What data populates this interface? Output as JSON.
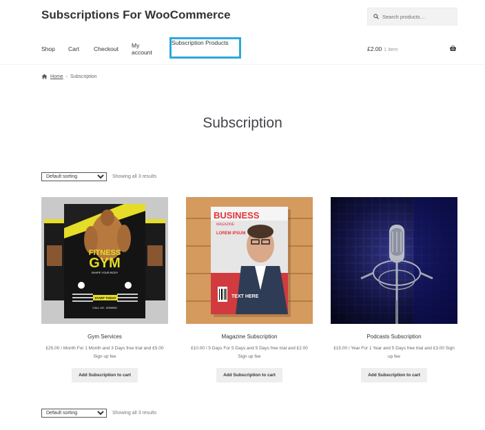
{
  "site": {
    "title": "Subscriptions For WooCommerce"
  },
  "search": {
    "placeholder": "Search products…"
  },
  "nav": {
    "shop": "Shop",
    "cart": "Cart",
    "checkout": "Checkout",
    "my_account": "My account",
    "subscription_products": "Subscription Products"
  },
  "cart": {
    "total": "£2.00",
    "count": "1 item"
  },
  "breadcrumb": {
    "home": "Home",
    "current": "Subscription"
  },
  "page": {
    "title": "Subscription"
  },
  "sorting": {
    "selected": "Default sorting",
    "result_count": "Showing all 3 results"
  },
  "products": [
    {
      "name": "Gym Services",
      "price": "£25.00 / Month For 1 Month and 3 Days free trial and £5.00 Sign up fee",
      "button": "Add Subscription to cart",
      "image_text": {
        "line1": "FITNESS",
        "line2": "GYM",
        "tagline": "SHAPE YOUR BODY",
        "cta": "START TODAY",
        "call": "CALL US : 0000000"
      }
    },
    {
      "name": "Magazine Subscription",
      "price": "£10.00 / 5 Days For 5 Days and 5 Days free trial and £2.00 Sign up fee",
      "button": "Add Subscription to cart",
      "image_text": {
        "masthead": "BUSINESS",
        "sub": "MAGAZINE",
        "headline": "LOREM IPSUM",
        "feature": "TEXT HERE"
      }
    },
    {
      "name": "Podcasts Subscription",
      "price": "£15.00 / Year For 1 Year and 5 Days free trial and £3.00 Sign up fee",
      "button": "Add Subscription to cart",
      "image_text": {}
    }
  ],
  "colors": {
    "highlight": "#2aa7e0",
    "button_bg": "#eeeeee",
    "search_bg": "#f2f2f2"
  }
}
